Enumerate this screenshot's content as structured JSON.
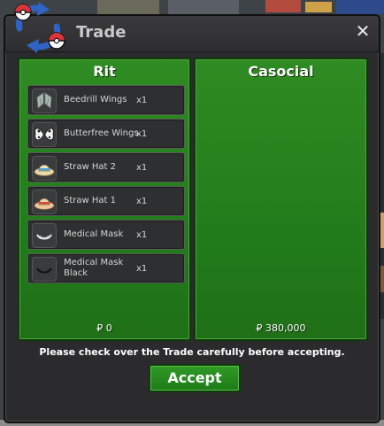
{
  "window": {
    "title": "Trade",
    "close_symbol": "✕"
  },
  "left_trader": {
    "name": "Rit",
    "money": "₽ 0",
    "items": [
      {
        "label": "Beedrill Wings",
        "qty": "x1",
        "icon": "beedrill-wings-icon"
      },
      {
        "label": "Butterfree Wings",
        "qty": "x1",
        "icon": "butterfree-wings-icon"
      },
      {
        "label": "Straw Hat 2",
        "qty": "x1",
        "icon": "straw-hat-2-icon"
      },
      {
        "label": "Straw Hat 1",
        "qty": "x1",
        "icon": "straw-hat-1-icon"
      },
      {
        "label": "Medical Mask",
        "qty": "x1",
        "icon": "medical-mask-icon"
      },
      {
        "label": "Medical Mask Black",
        "qty": "x1",
        "icon": "medical-mask-black-icon"
      }
    ]
  },
  "right_trader": {
    "name": "Casocial",
    "money": "₽ 380,000",
    "items": []
  },
  "notice": "Please check over the Trade carefully before accepting.",
  "accept_label": "Accept",
  "colors": {
    "panel_green": "#217a1a",
    "button_green": "#2f9a26",
    "window_bg": "#2b2b2d"
  }
}
